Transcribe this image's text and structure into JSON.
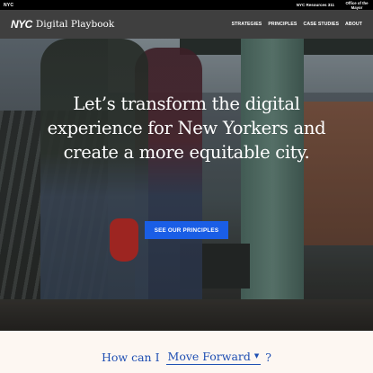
{
  "topbar": {
    "logo": "NYC",
    "resources_link": "NYC Resources 311",
    "office_link": "Office of the Mayor"
  },
  "navbar": {
    "logo": "NYC",
    "title": "Digital Playbook",
    "items": [
      "STRATEGIES",
      "PRINCIPLES",
      "CASE STUDIES",
      "ABOUT"
    ]
  },
  "hero": {
    "headline": "Let’s transform the digital experience for New Yorkers and create a more equitable city.",
    "cta_label": "SEE OUR PRINCIPLES"
  },
  "question": {
    "prefix": "How can I",
    "selected_option": "Move Forward",
    "suffix": "?"
  },
  "colors": {
    "accent": "#1a5ee6",
    "question_text": "#1f4fb3",
    "navbar": "#3f3f3f",
    "topbar": "#000000",
    "page_bg": "#fdf7f2"
  }
}
